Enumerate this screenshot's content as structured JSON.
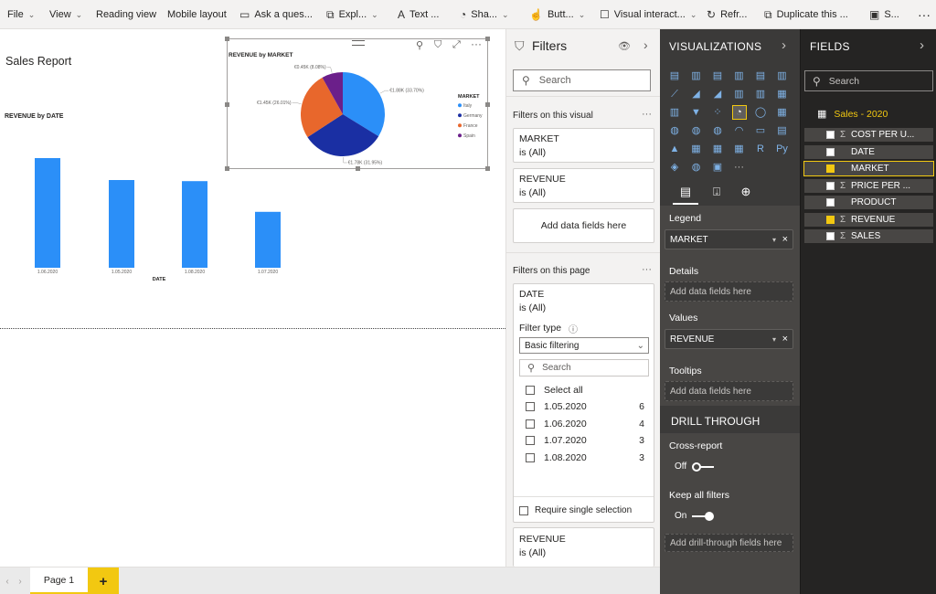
{
  "ribbon": {
    "items": [
      {
        "label": "File",
        "icon": "",
        "chevron": true
      },
      {
        "label": "View",
        "icon": "",
        "chevron": true
      },
      {
        "label": "Reading view",
        "icon": "",
        "chevron": false
      },
      {
        "label": "Mobile layout",
        "icon": "",
        "chevron": false
      },
      {
        "label": "Ask a ques...",
        "icon": "chat-icon",
        "chevron": false
      },
      {
        "label": "Expl...",
        "icon": "explore-icon",
        "chevron": true
      },
      {
        "label": "Text ...",
        "icon": "text-icon",
        "chevron": false
      },
      {
        "label": "Sha...",
        "icon": "shapes-icon",
        "chevron": true
      },
      {
        "label": "Butt...",
        "icon": "buttons-icon",
        "chevron": true
      },
      {
        "label": "Visual interact...",
        "icon": "checkbox-icon",
        "chevron": true
      },
      {
        "label": "Refr...",
        "icon": "refresh-icon",
        "chevron": false
      },
      {
        "label": "Duplicate this ...",
        "icon": "duplicate-icon",
        "chevron": false
      },
      {
        "label": "S...",
        "icon": "save-icon",
        "chevron": false
      }
    ],
    "more": "···"
  },
  "canvas": {
    "report_title": "Sales Report",
    "bar_title": "REVENUE by DATE",
    "pie_title": "REVENUE by MARKET"
  },
  "chart_data": [
    {
      "type": "bar",
      "title": "REVENUE by DATE",
      "xlabel": "DATE",
      "ylabel": "",
      "categories": [
        "1.06.2020",
        "1.05.2020",
        "1.08.2020",
        "1.07.2020"
      ],
      "values": [
        1.0,
        0.8,
        0.79,
        0.51
      ],
      "color": "#2b8ff8"
    },
    {
      "type": "pie",
      "title": "REVENUE by MARKET",
      "legend_title": "MARKET",
      "legend_position": "right",
      "slices": [
        {
          "name": "Italy",
          "value": 33.7,
          "label": "€1.88K (33.70%)",
          "color": "#2b8ff8"
        },
        {
          "name": "Germany",
          "value": 31.95,
          "label": "€1.78K (31.95%)",
          "color": "#1a2fa3"
        },
        {
          "name": "France",
          "value": 26.01,
          "label": "€1.45K (26.01%)",
          "color": "#e8672c"
        },
        {
          "name": "Spain",
          "value": 8.08,
          "label": "€0.45K (8.08%)",
          "color": "#6b1f8a"
        }
      ]
    }
  ],
  "filters": {
    "title": "Filters",
    "search_placeholder": "Search",
    "on_visual_label": "Filters on this visual",
    "visual_cards": [
      {
        "field": "MARKET",
        "state": "is (All)"
      },
      {
        "field": "REVENUE",
        "state": "is (All)"
      }
    ],
    "add_fields": "Add data fields here",
    "on_page_label": "Filters on this page",
    "date_card": {
      "field": "DATE",
      "state": "is (All)",
      "filter_type_label": "Filter type",
      "filter_type_value": "Basic filtering",
      "search_placeholder": "Search",
      "select_all": "Select all",
      "options": [
        {
          "label": "1.05.2020",
          "count": "6"
        },
        {
          "label": "1.06.2020",
          "count": "4"
        },
        {
          "label": "1.07.2020",
          "count": "3"
        },
        {
          "label": "1.08.2020",
          "count": "3"
        }
      ],
      "require_single": "Require single selection"
    },
    "revenue_page_card": {
      "field": "REVENUE",
      "state": "is (All)"
    },
    "more": "···"
  },
  "visualizations": {
    "title": "VISUALIZATIONS",
    "legend_label": "Legend",
    "legend_value": "MARKET",
    "details_label": "Details",
    "details_placeholder": "Add data fields here",
    "values_label": "Values",
    "values_value": "REVENUE",
    "tooltips_label": "Tooltips",
    "tooltips_placeholder": "Add data fields here",
    "drill_title": "DRILL THROUGH",
    "cross_report_label": "Cross-report",
    "cross_report_state": "Off",
    "keep_filters_label": "Keep all filters",
    "keep_filters_state": "On",
    "drill_placeholder": "Add drill-through fields here",
    "more": "···"
  },
  "fields": {
    "title": "FIELDS",
    "search_placeholder": "Search",
    "table_name": "Sales - 2020",
    "items": [
      {
        "label": "COST PER U...",
        "sigma": true,
        "checked": false
      },
      {
        "label": "DATE",
        "sigma": false,
        "checked": false
      },
      {
        "label": "MARKET",
        "sigma": false,
        "checked": true
      },
      {
        "label": "PRICE PER ...",
        "sigma": true,
        "checked": false
      },
      {
        "label": "PRODUCT",
        "sigma": false,
        "checked": false
      },
      {
        "label": "REVENUE",
        "sigma": true,
        "checked": true
      },
      {
        "label": "SALES",
        "sigma": true,
        "checked": false
      }
    ]
  },
  "pages": {
    "tab_label": "Page 1",
    "add_label": "+"
  },
  "colors": {
    "accent": "#f2c811",
    "bar": "#2b8ff8",
    "viz_bg": "#3b3a39",
    "fields_bg": "#252423"
  }
}
